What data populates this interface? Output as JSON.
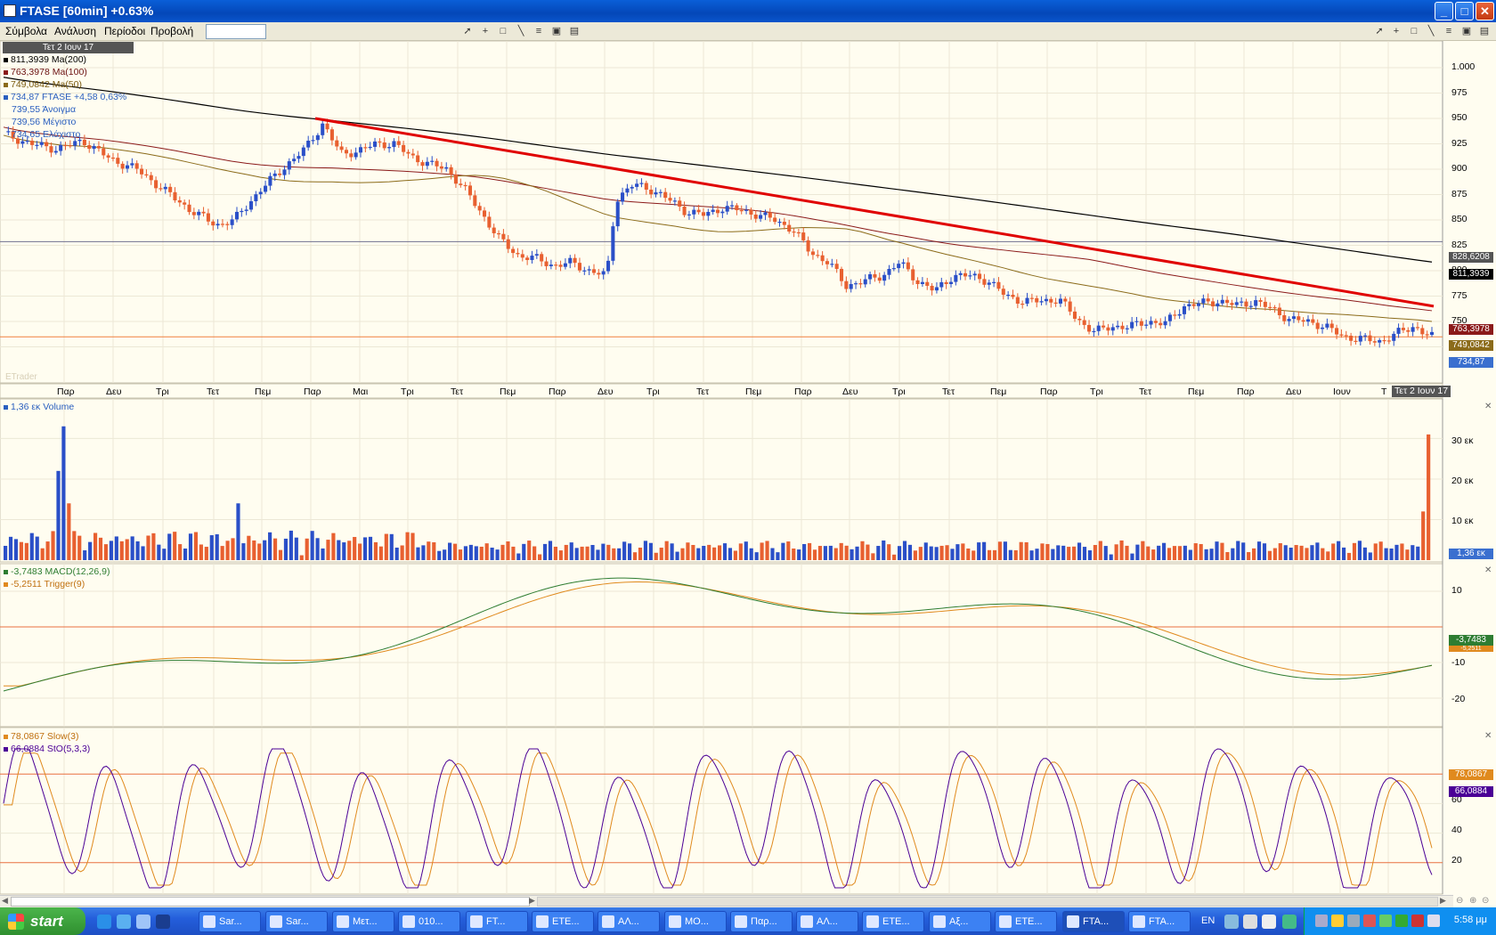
{
  "window": {
    "title": "FTASE [60min] +0.63%"
  },
  "menu": {
    "items": [
      "Σύμβολα",
      "Ανάλυση",
      "Περίοδοι",
      "Προβολή"
    ],
    "symbol_value": ""
  },
  "price_panel": {
    "date_label": "Τετ 2 Ιουν 17",
    "legend": {
      "ma200": "811,3939 Ma(200)",
      "ma100": "763,3978 Ma(100)",
      "ma50": "749,0842 Ma(50)",
      "last": "734,87 FTASE +4,58 0,63%",
      "open": "739,55 Άνοιγμα",
      "high": "739,56 Μέγιστο",
      "low": "734,65 Ελάχιστο"
    },
    "yticks": [
      "1.000",
      "975",
      "950",
      "925",
      "900",
      "875",
      "850",
      "825",
      "800",
      "775",
      "750",
      "725"
    ],
    "xticks": [
      "Παρ",
      "Δευ",
      "Τρι",
      "Τετ",
      "Πεμ",
      "Παρ",
      "Μαι",
      "Τρι",
      "Τετ",
      "Πεμ",
      "Παρ",
      "Δευ",
      "Τρι",
      "Τετ",
      "Πεμ",
      "Παρ",
      "Δευ",
      "Τρι",
      "Τετ",
      "Πεμ",
      "Παρ",
      "Τρι",
      "Τετ",
      "Πεμ",
      "Παρ",
      "Δευ",
      "Ιουν",
      "Τ"
    ],
    "tags": {
      "crosshair": "828,6208",
      "ma200": "811,3939",
      "ma100": "763,3978",
      "ma50": "749,0842",
      "last": "734,87",
      "xdate": "Τετ 2 Ιουν 17"
    },
    "watermark": "ETrader"
  },
  "volume_panel": {
    "legend": "1,36 εκ Volume",
    "yticks": [
      "30 εκ",
      "20 εκ",
      "10 εκ"
    ],
    "tag": "1,36 εκ"
  },
  "macd_panel": {
    "legend_macd": "-3,7483 MACD(12,26,9)",
    "legend_trigger": "-5,2511 Trigger(9)",
    "yticks": [
      "10",
      "-10",
      "-20"
    ],
    "tag_macd": "-3,7483",
    "tag_trigger": "-5,2511"
  },
  "stoch_panel": {
    "legend_slow": "78,0867 Slow(3)",
    "legend_sto": "66,0884 StO(5,3,3)",
    "yticks": [
      "60",
      "40",
      "20"
    ],
    "tag_slow": "78,0867",
    "tag_sto": "66,0884"
  },
  "chart_data": [
    {
      "type": "candlestick",
      "title": "FTASE [60min]",
      "ylim": [
        720,
        1010
      ],
      "moving_averages": [
        {
          "name": "Ma(200)",
          "color": "#000000",
          "start": 1000,
          "end": 811.39
        },
        {
          "name": "Ma(100)",
          "color": "#8b1a1a",
          "start": 945,
          "end": 763.4
        },
        {
          "name": "Ma(50)",
          "color": "#8b6b1a",
          "start": 925,
          "end": 749.08
        }
      ],
      "trendline": {
        "color": "#e00000",
        "from": 950,
        "to": 765
      },
      "last_close": 734.87,
      "horizontal_lines": [
        828.62,
        734.87
      ],
      "price_path": [
        [
          0,
          935
        ],
        [
          6,
          925
        ],
        [
          12,
          920
        ],
        [
          18,
          928
        ],
        [
          24,
          910
        ],
        [
          30,
          900
        ],
        [
          36,
          880
        ],
        [
          42,
          860
        ],
        [
          48,
          845
        ],
        [
          52,
          850
        ],
        [
          58,
          880
        ],
        [
          64,
          905
        ],
        [
          68,
          920
        ],
        [
          72,
          945
        ],
        [
          76,
          915
        ],
        [
          80,
          918
        ],
        [
          84,
          925
        ],
        [
          88,
          925
        ],
        [
          92,
          912
        ],
        [
          96,
          905
        ],
        [
          100,
          900
        ],
        [
          104,
          880
        ],
        [
          108,
          855
        ],
        [
          112,
          830
        ],
        [
          116,
          815
        ],
        [
          120,
          812
        ],
        [
          124,
          805
        ],
        [
          128,
          808
        ],
        [
          132,
          800
        ],
        [
          136,
          795
        ],
        [
          138,
          870
        ],
        [
          142,
          885
        ],
        [
          146,
          880
        ],
        [
          150,
          870
        ],
        [
          154,
          858
        ],
        [
          158,
          855
        ],
        [
          162,
          862
        ],
        [
          166,
          860
        ],
        [
          170,
          855
        ],
        [
          174,
          850
        ],
        [
          178,
          840
        ],
        [
          182,
          818
        ],
        [
          186,
          808
        ],
        [
          190,
          785
        ],
        [
          194,
          790
        ],
        [
          198,
          795
        ],
        [
          202,
          808
        ],
        [
          206,
          790
        ],
        [
          210,
          780
        ],
        [
          214,
          795
        ],
        [
          218,
          795
        ],
        [
          222,
          790
        ],
        [
          226,
          775
        ],
        [
          230,
          770
        ],
        [
          234,
          770
        ],
        [
          238,
          772
        ],
        [
          242,
          752
        ],
        [
          246,
          740
        ],
        [
          250,
          745
        ],
        [
          254,
          745
        ],
        [
          258,
          750
        ],
        [
          262,
          748
        ],
        [
          266,
          765
        ],
        [
          270,
          768
        ],
        [
          274,
          770
        ],
        [
          278,
          766
        ],
        [
          282,
          770
        ],
        [
          286,
          762
        ],
        [
          290,
          752
        ],
        [
          294,
          750
        ],
        [
          298,
          745
        ],
        [
          302,
          735
        ],
        [
          306,
          733
        ],
        [
          310,
          730
        ],
        [
          314,
          738
        ],
        [
          318,
          745
        ],
        [
          322,
          735
        ]
      ]
    },
    {
      "type": "bar",
      "title": "Volume",
      "ylim": [
        0,
        38
      ],
      "spikes": [
        {
          "index": 10,
          "value": 22
        },
        {
          "index": 11,
          "value": 33
        },
        {
          "index": 12,
          "value": 14
        },
        {
          "index": 44,
          "value": 14
        },
        {
          "index": 268,
          "value": 12
        },
        {
          "index": 269,
          "value": 31
        }
      ],
      "typical_range": [
        1,
        8
      ]
    },
    {
      "type": "line",
      "title": "MACD(12,26,9)",
      "ylim": [
        -27,
        15
      ],
      "series": [
        {
          "name": "MACD(12,26,9)",
          "color": "#2e7d32",
          "last": -3.7483
        },
        {
          "name": "Trigger(9)",
          "color": "#e08a1e",
          "last": -5.2511
        }
      ],
      "zero_line": 0
    },
    {
      "type": "line",
      "title": "StO(5,3,3)",
      "ylim": [
        0,
        100
      ],
      "series": [
        {
          "name": "StO(5,3,3)",
          "color": "#4b0096",
          "last": 66.0884
        },
        {
          "name": "Slow(3)",
          "color": "#e08a1e",
          "last": 78.0867
        }
      ],
      "reference_lines": [
        80,
        20
      ]
    }
  ],
  "scrollbar": {},
  "taskbar": {
    "start_label": "start",
    "tasks": [
      "Sar...",
      "Sar...",
      "Μετ...",
      "010...",
      "FT...",
      "ETE...",
      "ΑΛ...",
      "ΜΟ...",
      "Παρ...",
      "ΑΛ...",
      "ETE...",
      "Αξ...",
      "ETE...",
      "FTA...",
      "FTA..."
    ],
    "active_task_index": 13,
    "language": "EN",
    "clock": "5:58 μμ"
  }
}
